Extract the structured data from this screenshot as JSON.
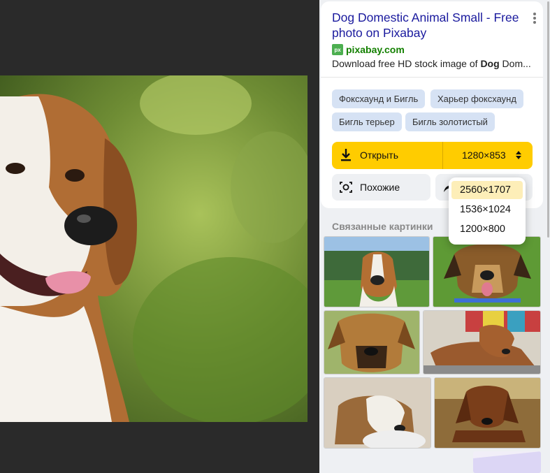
{
  "result": {
    "title": "Dog Domestic Animal Small - Free photo on Pixabay",
    "source_logo": "px",
    "source_name": "pixabay.com",
    "description_prefix": "Download free HD stock image of ",
    "description_bold": "Dog",
    "description_suffix": " Dom..."
  },
  "tags": [
    "Фоксхаунд и Бигль",
    "Харьер фоксхаунд",
    "Бигль терьер",
    "Бигль золотистый"
  ],
  "actions": {
    "open_label": "Открыть",
    "size_label": "1280×853",
    "similar_label": "Похожие"
  },
  "size_options": [
    {
      "label": "2560×1707",
      "selected": true
    },
    {
      "label": "1536×1024",
      "selected": false
    },
    {
      "label": "1200×800",
      "selected": false
    }
  ],
  "related": {
    "title": "Связанные картинки"
  },
  "colors": {
    "accent": "#ffcc00",
    "link": "#1a1a9e",
    "source": "#138000",
    "tag_bg": "#d6e2f4"
  }
}
